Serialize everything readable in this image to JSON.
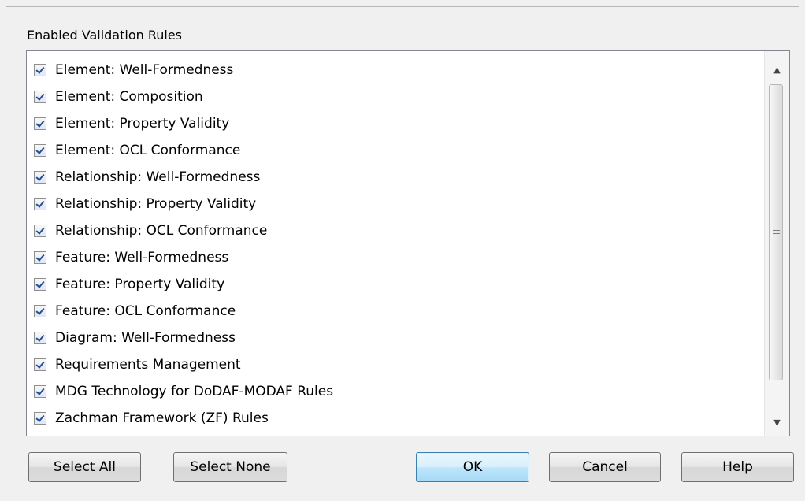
{
  "group": {
    "title": "Enabled Validation Rules"
  },
  "rules": [
    {
      "label": "Element: Well-Formedness",
      "checked": true
    },
    {
      "label": "Element: Composition",
      "checked": true
    },
    {
      "label": "Element: Property Validity",
      "checked": true
    },
    {
      "label": "Element: OCL Conformance",
      "checked": true
    },
    {
      "label": "Relationship: Well-Formedness",
      "checked": true
    },
    {
      "label": "Relationship: Property Validity",
      "checked": true
    },
    {
      "label": "Relationship: OCL Conformance",
      "checked": true
    },
    {
      "label": "Feature: Well-Formedness",
      "checked": true
    },
    {
      "label": "Feature: Property Validity",
      "checked": true
    },
    {
      "label": "Feature: OCL Conformance",
      "checked": true
    },
    {
      "label": "Diagram: Well-Formedness",
      "checked": true
    },
    {
      "label": "Requirements Management",
      "checked": true
    },
    {
      "label": "MDG Technology for DoDAF-MODAF Rules",
      "checked": true
    },
    {
      "label": "Zachman Framework (ZF) Rules",
      "checked": true
    }
  ],
  "buttons": {
    "select_all": "Select All",
    "select_none": "Select None",
    "ok": "OK",
    "cancel": "Cancel",
    "help": "Help"
  },
  "icons": {
    "checkbox": "checkmark-icon",
    "scroll_up": "scroll-up-arrow-icon",
    "scroll_down": "scroll-down-arrow-icon",
    "scroll_grip": "scroll-grip-icon"
  },
  "colors": {
    "dialog_background": "#f0f0f0",
    "list_background": "#ffffff",
    "check_color": "#244b95",
    "default_button_border": "#3c7fb1"
  }
}
